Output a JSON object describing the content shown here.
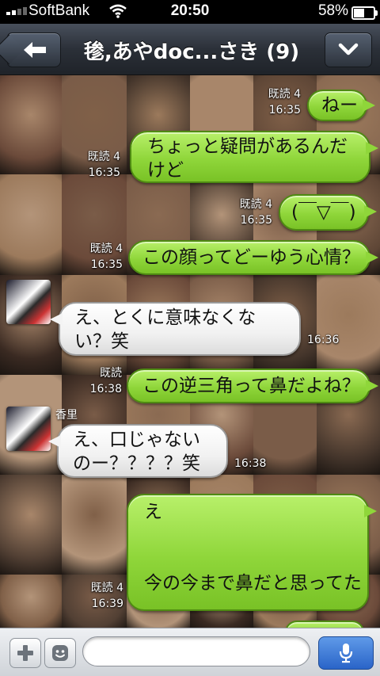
{
  "status_bar": {
    "carrier": "SoftBank",
    "time": "20:50",
    "battery_percent": "58%",
    "battery_level": 0.58
  },
  "nav": {
    "title": "毶,あやdoc...さき (9)",
    "back_icon": "back-arrow-icon",
    "menu_icon": "chevron-down-icon"
  },
  "messages": [
    {
      "side": "right",
      "text": "ねー",
      "read": "既読 4",
      "time": "16:35"
    },
    {
      "side": "right",
      "text": "ちょっと疑問があるんだけど",
      "read": "既読 4",
      "time": "16:35"
    },
    {
      "side": "right",
      "text": "(￣▽￣)",
      "read": "既読 4",
      "time": "16:35"
    },
    {
      "side": "right",
      "text": "この顔ってどーゆう心情？",
      "read": "既読 4",
      "time": "16:35"
    },
    {
      "side": "left",
      "text": "え、とくに意味なくない？笑",
      "time": "16:36"
    },
    {
      "side": "right",
      "text": "この逆三角って鼻だよね？",
      "read": "既読",
      "time": "16:38"
    },
    {
      "side": "left",
      "sender": "香里",
      "text": "え、口じゃないのー？？？？笑",
      "time": "16:38"
    },
    {
      "side": "right",
      "text_lines": [
        "え",
        "",
        "",
        "今の今まで鼻だと思ってた"
      ],
      "read": "既読 4",
      "time": "16:39"
    }
  ],
  "input": {
    "placeholder": "",
    "plus_icon": "plus-icon",
    "emoji_icon": "emoji-icon",
    "mic_icon": "microphone-icon"
  },
  "colors": {
    "green_bubble": "#9be24a",
    "white_bubble": "#ffffff",
    "nav_bar": "#2b3038",
    "mic_button": "#3a78d8"
  }
}
